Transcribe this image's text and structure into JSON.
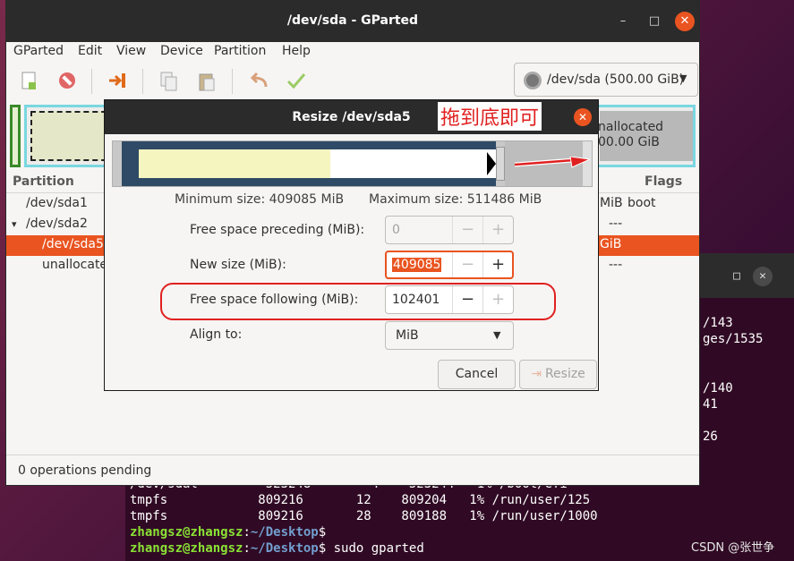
{
  "terminal": {
    "right_lines": [
      "/143",
      "ges/1535",
      "/140",
      "41",
      "26"
    ],
    "lines": [
      "/dev/sdal         523248        4    523244   1% /boot/efi",
      "tmpfs            809216       12    809204   1% /run/user/125",
      "tmpfs            809216       28    809188   1% /run/user/1000"
    ],
    "prompt_user": "zhangsz@zhangsz",
    "prompt_sep": ":",
    "prompt_path": "~/Desktop",
    "prompt_dollar": "$",
    "command": " sudo gparted",
    "window_buttons": {
      "max": "□",
      "close": "✕"
    }
  },
  "watermark": "CSDN @张世争",
  "gparted": {
    "title": "/dev/sda - GParted",
    "window_buttons": {
      "min": "–",
      "max": "□",
      "close": "✕"
    },
    "menu": [
      "GParted",
      "Edit",
      "View",
      "Device",
      "Partition",
      "Help"
    ],
    "device_combo": "/dev/sda (500.00 GiB)",
    "disk_unallocated_label": [
      "nallocated",
      "00.00 GiB"
    ],
    "table_headers": {
      "partition": "Partition",
      "flags": "Flags"
    },
    "rows": [
      {
        "name": "/dev/sda1",
        "size_tail": "MiB",
        "flags": "boot"
      },
      {
        "name": "/dev/sda2",
        "expander": "▾",
        "size_tail": "",
        "flags": "---"
      },
      {
        "name": "/dev/sda5",
        "size_tail": "GiB",
        "flags": ""
      },
      {
        "name": "unallocate",
        "size_tail": "",
        "flags": "---"
      }
    ],
    "status": "0 operations pending"
  },
  "dialog": {
    "title": "Resize /dev/sda5",
    "annotation": "拖到底即可",
    "close": "✕",
    "min_size": "Minimum size: 409085 MiB",
    "max_size": "Maximum size: 511486 MiB",
    "fields": {
      "preceding_label": "Free space preceding (MiB):",
      "preceding_value": "0",
      "new_size_label": "New size (MiB):",
      "new_size_value": "409085",
      "following_label": "Free space following (MiB):",
      "following_value": "102401",
      "align_label": "Align to:",
      "align_value": "MiB"
    },
    "spin_minus": "−",
    "spin_plus": "+",
    "cancel": "Cancel",
    "resize": "Resize",
    "colors": {
      "accent": "#e95420",
      "annotation": "#e02020",
      "partition_frame": "#2e4a66",
      "used": "#f5f5c0"
    }
  }
}
